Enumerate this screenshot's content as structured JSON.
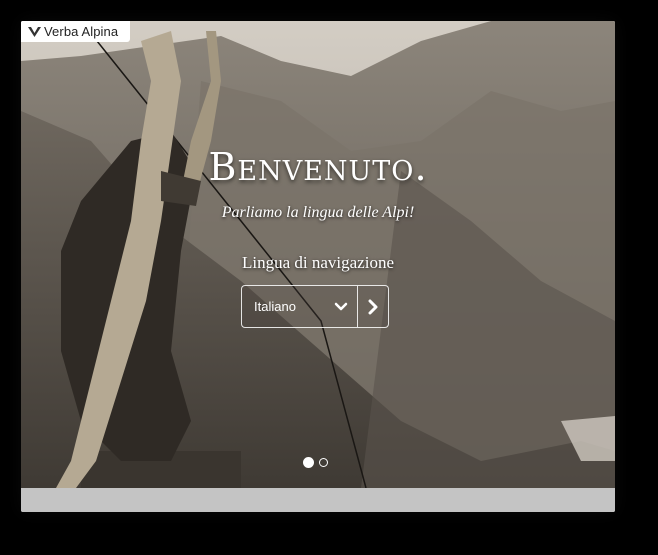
{
  "brand": {
    "name": "Verba Alpina",
    "logo_icon": "mountain-logo-icon"
  },
  "hero": {
    "title": "Benvenuto.",
    "tagline": "Parliamo la lingua delle Alpi!",
    "nav_label": "Lingua di navigazione"
  },
  "language_select": {
    "selected": "Italiano",
    "dropdown_icon": "chevron-down-icon",
    "go_icon": "chevron-right-icon"
  },
  "carousel": {
    "slides": 2,
    "active_index": 0
  },
  "colors": {
    "text": "#ffffff",
    "footer": "#c4c4c4",
    "brand_bg": "#ffffff"
  }
}
